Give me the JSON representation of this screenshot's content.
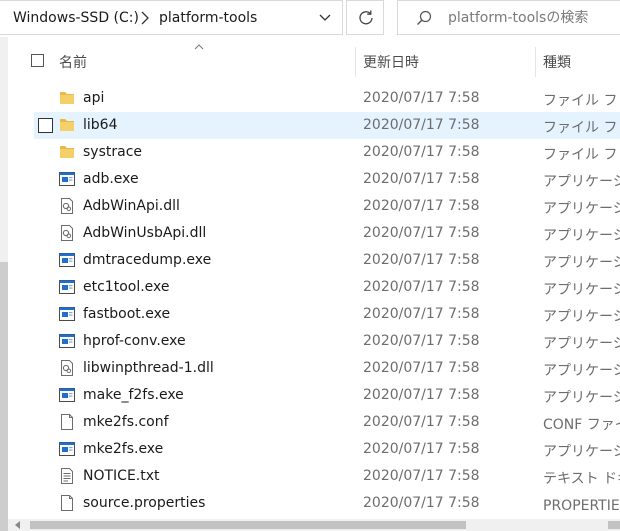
{
  "address_bar": {
    "crumb_drive": "Windows-SSD (C:)",
    "crumb_folder": "platform-tools"
  },
  "search": {
    "placeholder": "platform-toolsの検索"
  },
  "columns": {
    "name": "名前",
    "date": "更新日時",
    "type": "種類"
  },
  "files": [
    {
      "name": "api",
      "date": "2020/07/17 7:58",
      "type": "ファイル フォルダー",
      "icon": "folder-icon"
    },
    {
      "name": "lib64",
      "date": "2020/07/17 7:58",
      "type": "ファイル フォルダー",
      "icon": "folder-icon",
      "hovered": true
    },
    {
      "name": "systrace",
      "date": "2020/07/17 7:58",
      "type": "ファイル フォルダー",
      "icon": "folder-icon"
    },
    {
      "name": "adb.exe",
      "date": "2020/07/17 7:58",
      "type": "アプリケーション",
      "icon": "exe-icon"
    },
    {
      "name": "AdbWinApi.dll",
      "date": "2020/07/17 7:58",
      "type": "アプリケーション拡張",
      "icon": "dll-icon"
    },
    {
      "name": "AdbWinUsbApi.dll",
      "date": "2020/07/17 7:58",
      "type": "アプリケーション拡張",
      "icon": "dll-icon"
    },
    {
      "name": "dmtracedump.exe",
      "date": "2020/07/17 7:58",
      "type": "アプリケーション",
      "icon": "exe-icon"
    },
    {
      "name": "etc1tool.exe",
      "date": "2020/07/17 7:58",
      "type": "アプリケーション",
      "icon": "exe-icon"
    },
    {
      "name": "fastboot.exe",
      "date": "2020/07/17 7:58",
      "type": "アプリケーション",
      "icon": "exe-icon"
    },
    {
      "name": "hprof-conv.exe",
      "date": "2020/07/17 7:58",
      "type": "アプリケーション",
      "icon": "exe-icon"
    },
    {
      "name": "libwinpthread-1.dll",
      "date": "2020/07/17 7:58",
      "type": "アプリケーション拡張",
      "icon": "dll-icon"
    },
    {
      "name": "make_f2fs.exe",
      "date": "2020/07/17 7:58",
      "type": "アプリケーション",
      "icon": "exe-icon"
    },
    {
      "name": "mke2fs.conf",
      "date": "2020/07/17 7:58",
      "type": "CONF ファイル",
      "icon": "file-icon"
    },
    {
      "name": "mke2fs.exe",
      "date": "2020/07/17 7:58",
      "type": "アプリケーション",
      "icon": "exe-icon"
    },
    {
      "name": "NOTICE.txt",
      "date": "2020/07/17 7:58",
      "type": "テキスト ドキュメント",
      "icon": "text-file-icon"
    },
    {
      "name": "source.properties",
      "date": "2020/07/17 7:58",
      "type": "PROPERTIES ファイル",
      "icon": "file-icon"
    }
  ],
  "colors": {
    "hover_row": "#e5f3ff",
    "folder": "#e8b84a",
    "exe_accent": "#1e6fd0"
  }
}
